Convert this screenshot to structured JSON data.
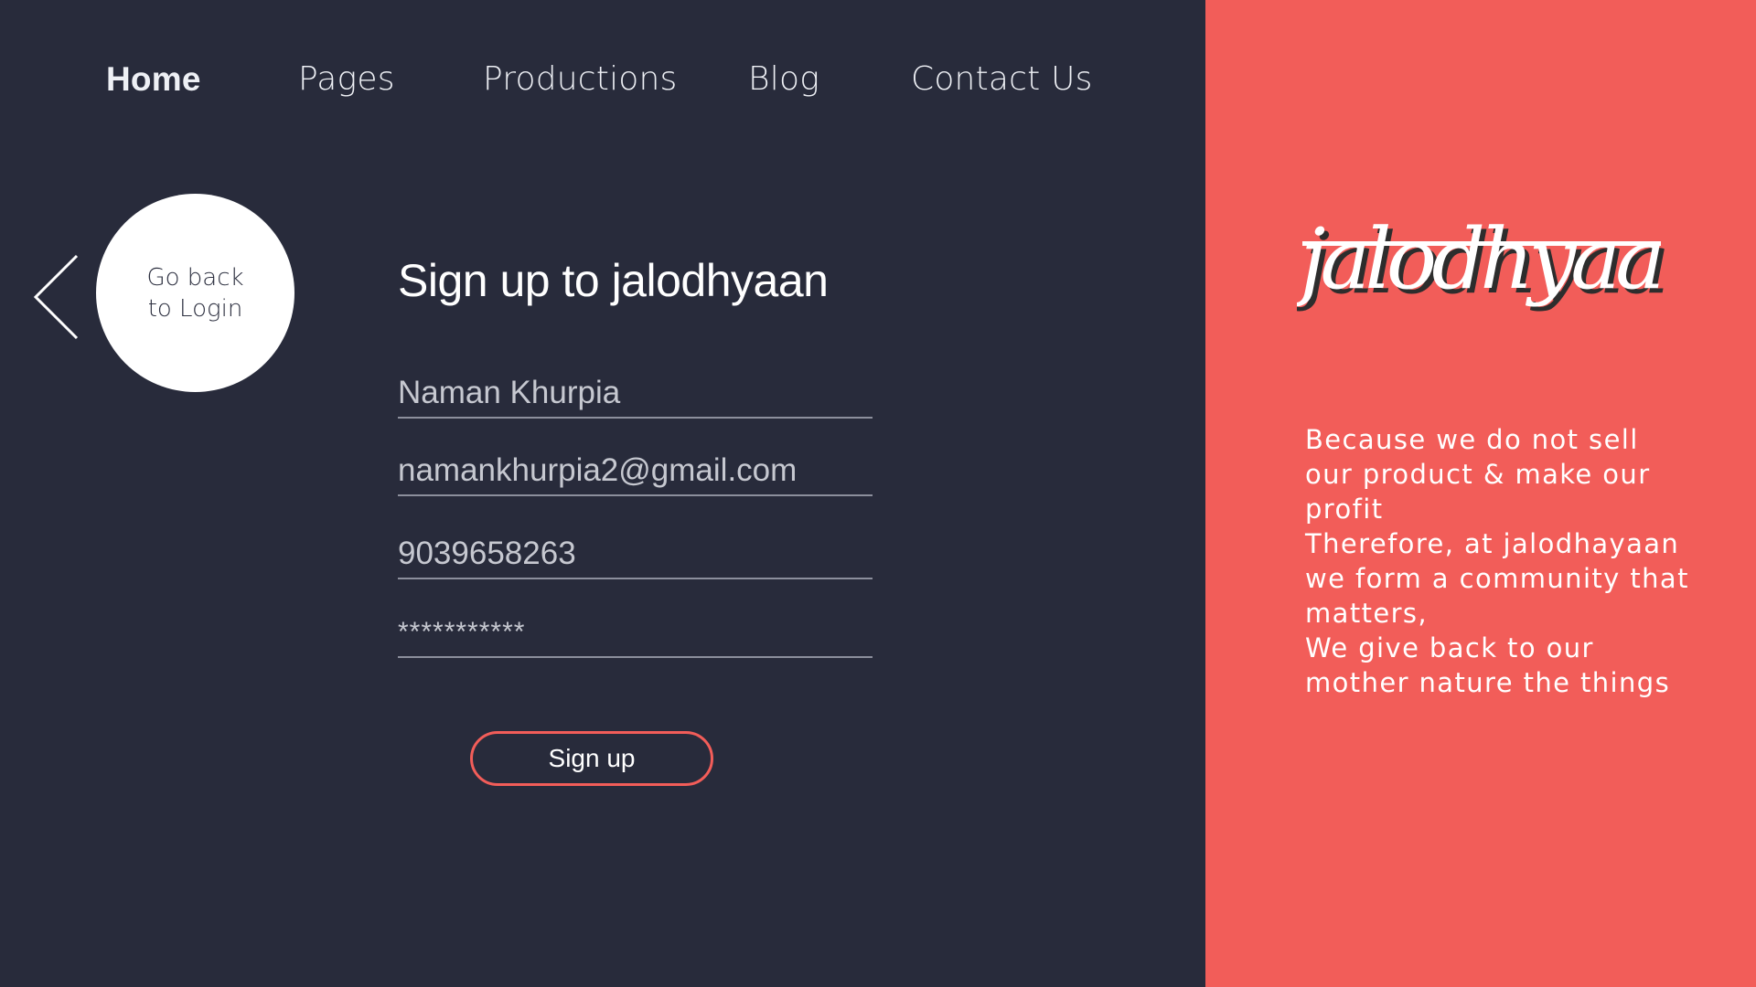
{
  "nav": {
    "items": [
      {
        "label": "Home",
        "active": true
      },
      {
        "label": "Pages",
        "active": false
      },
      {
        "label": "Productions",
        "active": false
      },
      {
        "label": "Blog",
        "active": false
      },
      {
        "label": "Contact Us",
        "active": false
      }
    ]
  },
  "back": {
    "icon": "chevron-left-icon",
    "line1": "Go back",
    "line2": "to Login"
  },
  "form": {
    "title": "Sign up to jalodhyaan",
    "name_value": "Naman Khurpia",
    "email_value": "namankhurpia2@gmail.com",
    "phone_value": "9039658263",
    "password_value": "***********",
    "submit_label": "Sign up"
  },
  "brand": {
    "logo_text": "jalodhyaan",
    "lines": [
      "Because we do not sell",
      "our product & make our",
      "profit",
      "Therefore, at jalodhayaan",
      "we form a community that",
      "matters,",
      "We give back to our",
      "mother nature the things"
    ]
  },
  "colors": {
    "background": "#282b3b",
    "accent": "#f25d59",
    "text": "#ffffff"
  }
}
